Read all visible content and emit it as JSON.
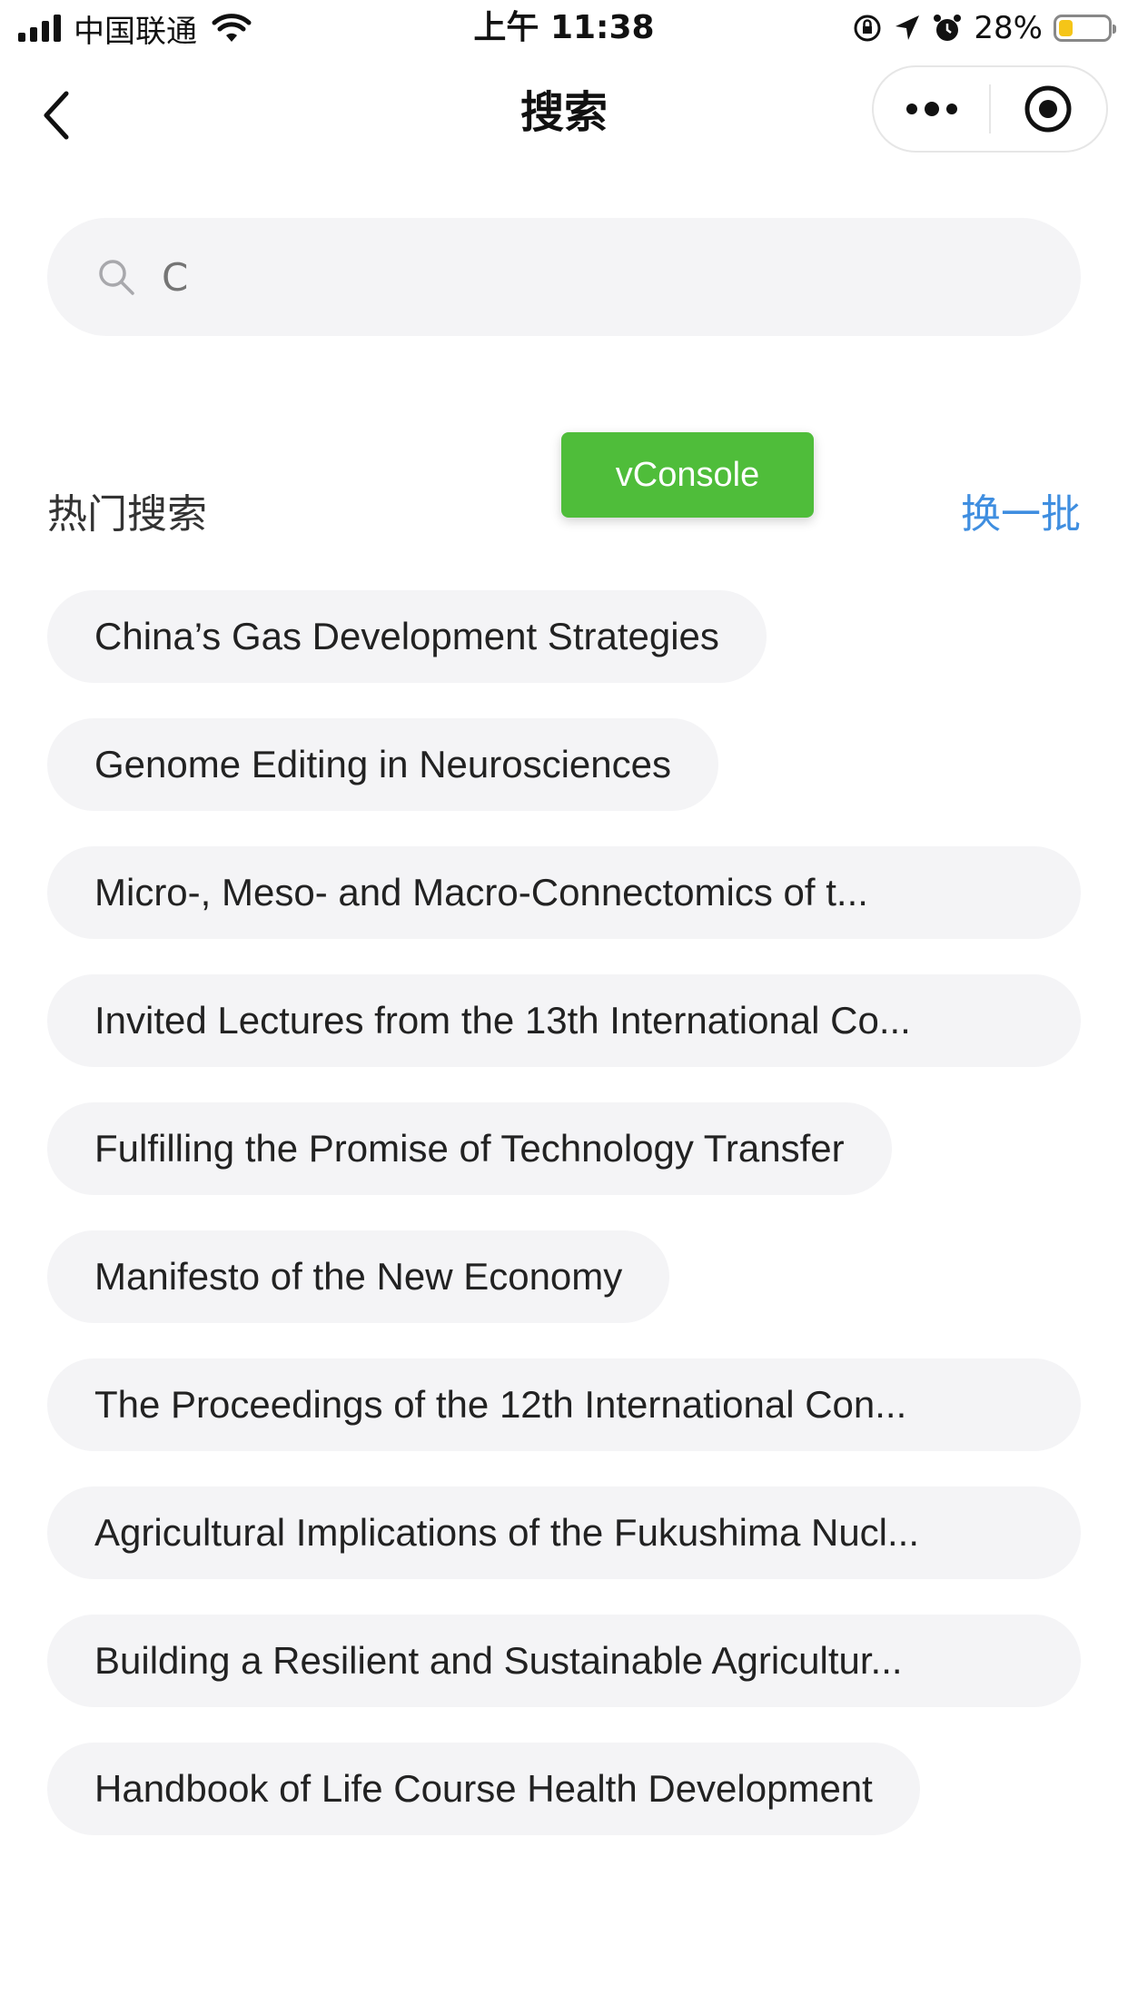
{
  "status_bar": {
    "carrier": "中国联通",
    "time": "上午 11:38",
    "battery_percent": "28%",
    "battery_level": 0.28,
    "icons": [
      "signal-icon",
      "wifi-icon",
      "orientation-lock-icon",
      "location-icon",
      "alarm-icon",
      "battery-icon"
    ]
  },
  "nav": {
    "title": "搜索",
    "back_icon": "chevron-left-icon",
    "more_icon": "more-dots-icon",
    "close_icon": "target-circle-icon"
  },
  "search": {
    "placeholder": "C",
    "icon": "search-icon"
  },
  "vconsole": {
    "label": "vConsole",
    "color": "#4fbd3a"
  },
  "hot_search": {
    "title": "热门搜索",
    "refresh_label": "换一批",
    "refresh_color": "#3f8ee0",
    "items": [
      "China’s Gas Development Strategies",
      "Genome Editing in Neurosciences",
      "Micro-, Meso- and Macro-Connectomics of t...",
      "Invited Lectures from the 13th International Co...",
      "Fulfilling the Promise of Technology Transfer",
      "Manifesto of the New Economy",
      "The Proceedings of the 12th International Con...",
      "Agricultural Implications of the Fukushima Nucl...",
      "Building a Resilient and Sustainable Agricultur...",
      "Handbook of Life Course Health Development"
    ]
  }
}
